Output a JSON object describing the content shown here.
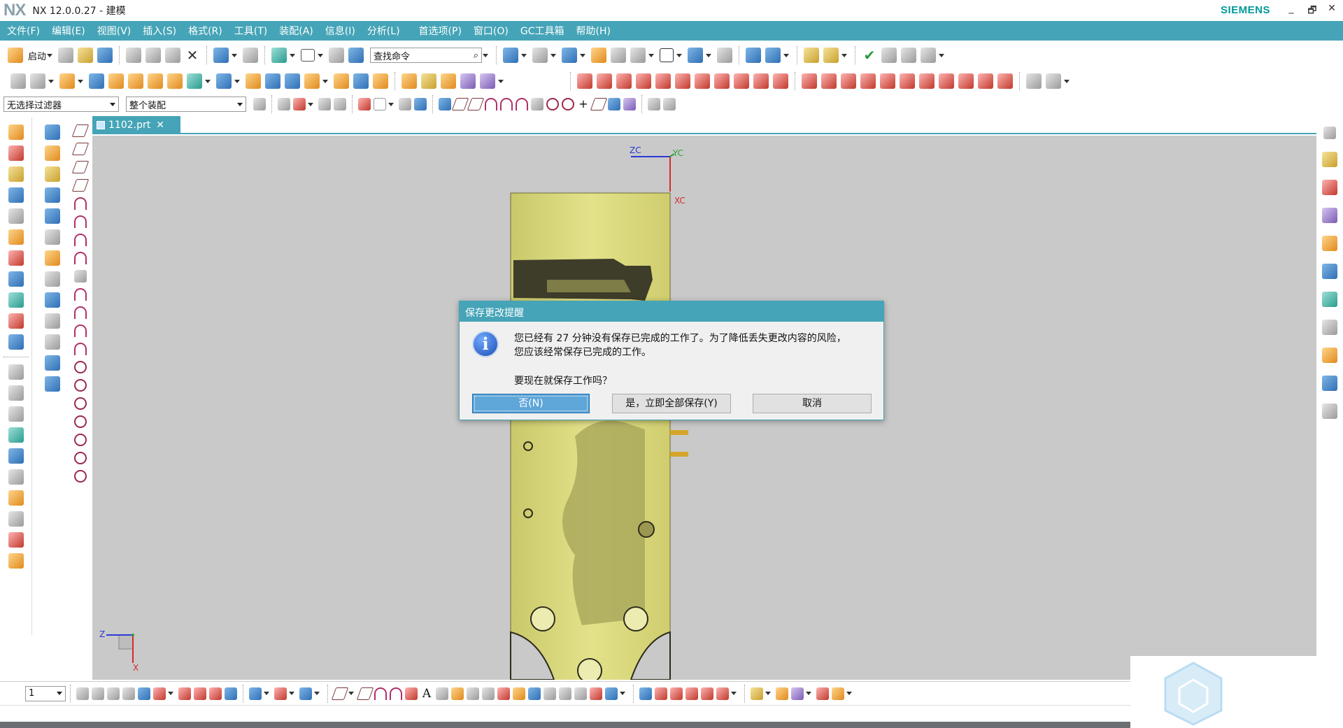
{
  "window": {
    "logo": "NX",
    "title": "NX 12.0.0.27 - 建模",
    "brand": "SIEMENS",
    "minimize": "_",
    "restore": "🗗",
    "close": "✕"
  },
  "menubar": {
    "items": [
      "文件(F)",
      "编辑(E)",
      "视图(V)",
      "插入(S)",
      "格式(R)",
      "工具(T)",
      "装配(A)",
      "信息(I)",
      "分析(L)",
      "首选项(P)",
      "窗口(O)",
      "GC工具箱",
      "帮助(H)"
    ]
  },
  "toolbar": {
    "start_label": "启动",
    "search_placeholder": "查找命令",
    "filter_value": "无选择过滤器",
    "assembly_value": "整个装配"
  },
  "tab": {
    "label": "1102.prt"
  },
  "viewport": {
    "axis_zc": "ZC",
    "axis_yc": "YC",
    "axis_xc": "XC",
    "triad_z": "Z",
    "triad_x": "X",
    "part_color": "#dcdc78",
    "background": "#c9c9c9"
  },
  "bottombar": {
    "layer_value": "1"
  },
  "dialog": {
    "title": "保存更改提醒",
    "message_line1": "您已经有 27 分钟没有保存已完成的工作了。为了降低丢失更改内容的风险，",
    "message_line2": "您应该经常保存已完成的工作。",
    "question": "要现在就保存工作吗？",
    "btn_no": "否(N)",
    "btn_yes": "是，立即全部保存(Y)",
    "btn_cancel": "取消",
    "info_icon": "i",
    "accent_color": "#45a4b7"
  }
}
